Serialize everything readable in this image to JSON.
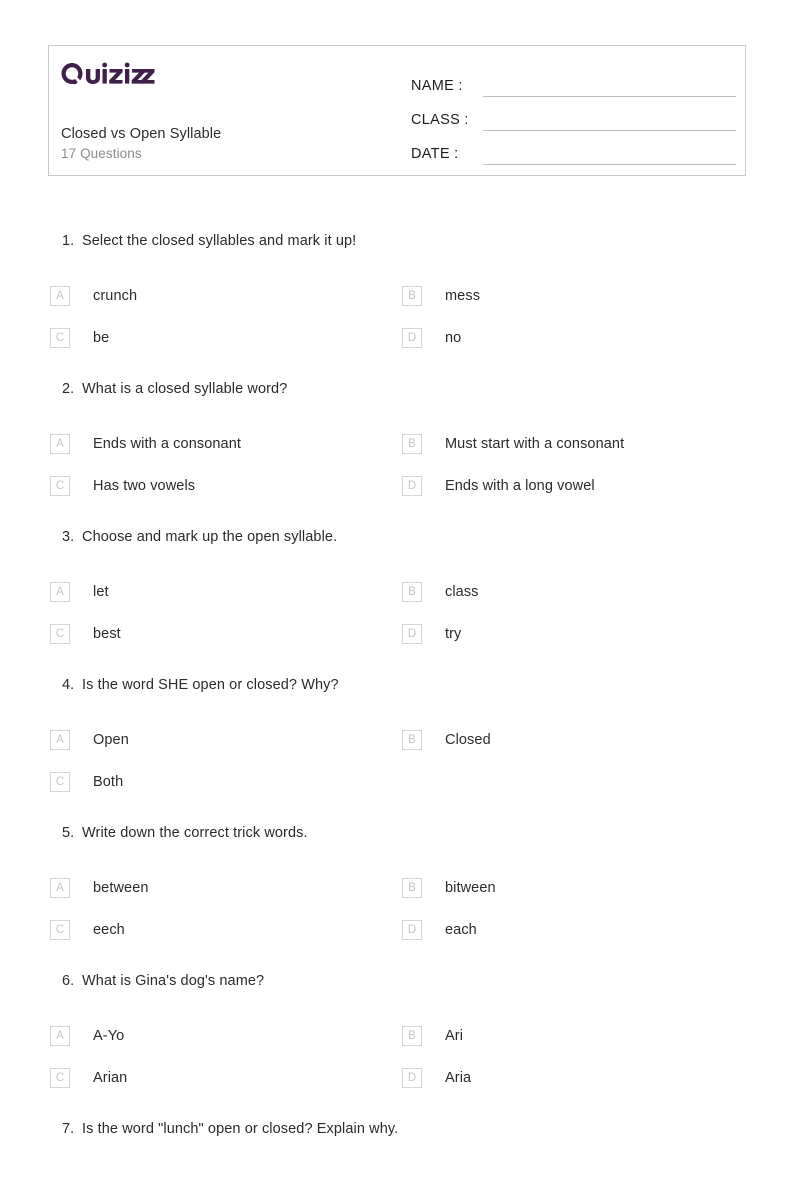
{
  "brand": {
    "logo_text": "Quizizz",
    "logo_color": "#40204a"
  },
  "header": {
    "title": "Closed vs Open Syllable",
    "subtitle": "17 Questions",
    "fields": [
      {
        "label": "NAME :",
        "value": ""
      },
      {
        "label": "CLASS :",
        "value": ""
      },
      {
        "label": "DATE  :",
        "value": ""
      }
    ]
  },
  "questions": [
    {
      "number": "1.",
      "text": "Select the closed syllables and mark it up!",
      "options": [
        {
          "letter": "A",
          "text": "crunch"
        },
        {
          "letter": "B",
          "text": "mess"
        },
        {
          "letter": "C",
          "text": "be"
        },
        {
          "letter": "D",
          "text": "no"
        }
      ]
    },
    {
      "number": "2.",
      "text": "What is a closed syllable word?",
      "options": [
        {
          "letter": "A",
          "text": "Ends with a consonant"
        },
        {
          "letter": "B",
          "text": "Must start with a consonant"
        },
        {
          "letter": "C",
          "text": "Has two vowels"
        },
        {
          "letter": "D",
          "text": "Ends with a long vowel"
        }
      ]
    },
    {
      "number": "3.",
      "text": "Choose and mark up the open syllable.",
      "options": [
        {
          "letter": "A",
          "text": "let"
        },
        {
          "letter": "B",
          "text": "class"
        },
        {
          "letter": "C",
          "text": "best"
        },
        {
          "letter": "D",
          "text": "try"
        }
      ]
    },
    {
      "number": "4.",
      "text": "Is the word SHE open or closed? Why?",
      "options": [
        {
          "letter": "A",
          "text": "Open"
        },
        {
          "letter": "B",
          "text": "Closed"
        },
        {
          "letter": "C",
          "text": "Both"
        }
      ]
    },
    {
      "number": "5.",
      "text": "Write down the correct trick words.",
      "options": [
        {
          "letter": "A",
          "text": "between"
        },
        {
          "letter": "B",
          "text": "bitween"
        },
        {
          "letter": "C",
          "text": "eech"
        },
        {
          "letter": "D",
          "text": "each"
        }
      ]
    },
    {
      "number": "6.",
      "text": "What is Gina's dog's name?",
      "options": [
        {
          "letter": "A",
          "text": "A-Yo"
        },
        {
          "letter": "B",
          "text": "Ari"
        },
        {
          "letter": "C",
          "text": "Arian"
        },
        {
          "letter": "D",
          "text": "Aria"
        }
      ]
    },
    {
      "number": "7.",
      "text": "Is the word \"lunch\" open or closed? Explain why.",
      "options": []
    }
  ]
}
